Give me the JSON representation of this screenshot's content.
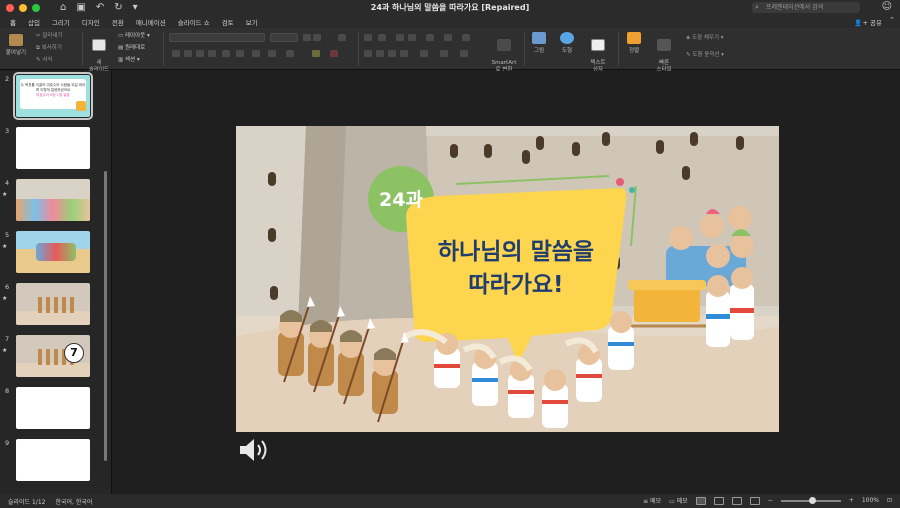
{
  "window": {
    "title": "24과 하나님의 말씀을 따라가요 [Repaired]",
    "search_placeholder": "프레젠테이션에서 검색"
  },
  "ribbon_tabs": [
    "홈",
    "삽입",
    "그리기",
    "디자인",
    "전환",
    "애니메이션",
    "슬라이드 쇼",
    "검토",
    "보기"
  ],
  "share_label": "공유",
  "ribbon": {
    "paste": "붙여넣기",
    "cut": "잘라내기",
    "copy": "복사하기",
    "format": "서식",
    "new_slide": "새\n슬라이드",
    "layout": "레이아웃",
    "reset": "원래대로",
    "section": "섹션",
    "smartart": "SmartArt\n로 변환",
    "picture": "그림",
    "shape": "도형",
    "textbox": "텍스트\n상자",
    "arrange": "정렬",
    "quick_styles": "빠른\n스타일",
    "shape_fill": "도형 채우기",
    "shape_outline": "도형 윤곽선"
  },
  "thumbnails": [
    {
      "num": "2",
      "star": false,
      "selected": true,
      "kind": "title"
    },
    {
      "num": "3",
      "star": false,
      "selected": false,
      "kind": "blank"
    },
    {
      "num": "4",
      "star": true,
      "selected": false,
      "kind": "crowd"
    },
    {
      "num": "5",
      "star": true,
      "selected": false,
      "kind": "desert"
    },
    {
      "num": "6",
      "star": true,
      "selected": false,
      "kind": "wall"
    },
    {
      "num": "7",
      "star": true,
      "selected": false,
      "kind": "wall7"
    },
    {
      "num": "8",
      "star": false,
      "selected": false,
      "kind": "blank"
    },
    {
      "num": "9",
      "star": false,
      "selected": false,
      "kind": "blank"
    }
  ],
  "thumb_texts": {
    "slide2_title": "두 목표를 이끌어 여호수아 사람들 되길 바라며 이렇게 말씀하셨어요",
    "slide2_sub": "여호수아 6장 1절 말씀",
    "slide7_badge": "7"
  },
  "slide": {
    "lesson_number": "24과",
    "title_line1": "하나님의 말씀을",
    "title_line2": "따라가요!",
    "colors": {
      "circle": "#8dc264",
      "banner": "#fdd54f",
      "title": "#1f3d6e",
      "sand": "#e3d1bb"
    }
  },
  "status": {
    "slide_indicator": "슬라이드 1/12",
    "language": "한국어, 한국어",
    "notes": "메모",
    "comments": "메모",
    "zoom": "100%"
  }
}
